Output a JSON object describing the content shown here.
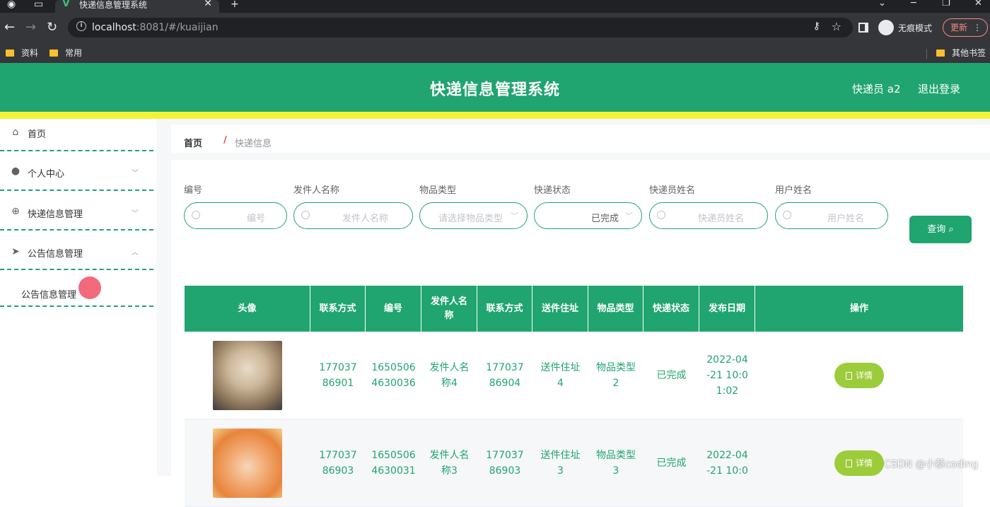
{
  "browser": {
    "tab_title": "快递信息管理系统",
    "url_host": "localhost",
    "url_rest": ":8081/#/kuaijian",
    "incognito_label": "无痕模式",
    "update_label": "更新",
    "bookmarks": [
      "资料",
      "常用"
    ],
    "other_bookmarks": "其他书签"
  },
  "header": {
    "title": "快递信息管理系统",
    "user": "快递员 a2",
    "logout": "退出登录",
    "bg_color": "#20a470",
    "accent_bar_color": "#f4f237"
  },
  "sidebar": {
    "items": [
      {
        "label": "首页",
        "icon": "home-icon"
      },
      {
        "label": "个人中心",
        "icon": "user-icon"
      },
      {
        "label": "快递信息管理",
        "icon": "globe-icon"
      },
      {
        "label": "公告信息管理",
        "icon": "send-icon"
      }
    ],
    "sub_items": [
      {
        "label": "公告信息管理"
      }
    ]
  },
  "breadcrumb": {
    "home": "首页",
    "separator": "/",
    "current": "快递信息"
  },
  "search": {
    "fields": [
      {
        "label": "编号",
        "placeholder": "编号"
      },
      {
        "label": "发件人名称",
        "placeholder": "发件人名称"
      },
      {
        "label": "物品类型",
        "placeholder": "请选择物品类型"
      },
      {
        "label": "快递状态",
        "value": "已完成"
      },
      {
        "label": "快递员姓名",
        "placeholder": "快递员姓名"
      },
      {
        "label": "用户姓名",
        "placeholder": "用户姓名"
      }
    ],
    "query_label": "查询"
  },
  "table": {
    "headers": [
      "头像",
      "联系方式",
      "编号",
      "发件人名称",
      "联系方式",
      "送件住址",
      "物品类型",
      "快递状态",
      "发布日期",
      "操作"
    ],
    "rows": [
      {
        "phone": "17703786901",
        "number": "16505064630036",
        "sender": "发件人名称4",
        "phone2": "17703786904",
        "address": "送件住址4",
        "type": "物品类型2",
        "status": "已完成",
        "date": "2022-04-21 10:01:02",
        "action": "详情"
      },
      {
        "phone": "17703786903",
        "number": "16505064630031",
        "sender": "发件人名称3",
        "phone2": "17703786903",
        "address": "送件住址3",
        "type": "物品类型3",
        "status": "已完成",
        "date": "2022-04-21 10:0",
        "action": "详情"
      }
    ]
  },
  "watermark": "CSDN @小蔡coding"
}
